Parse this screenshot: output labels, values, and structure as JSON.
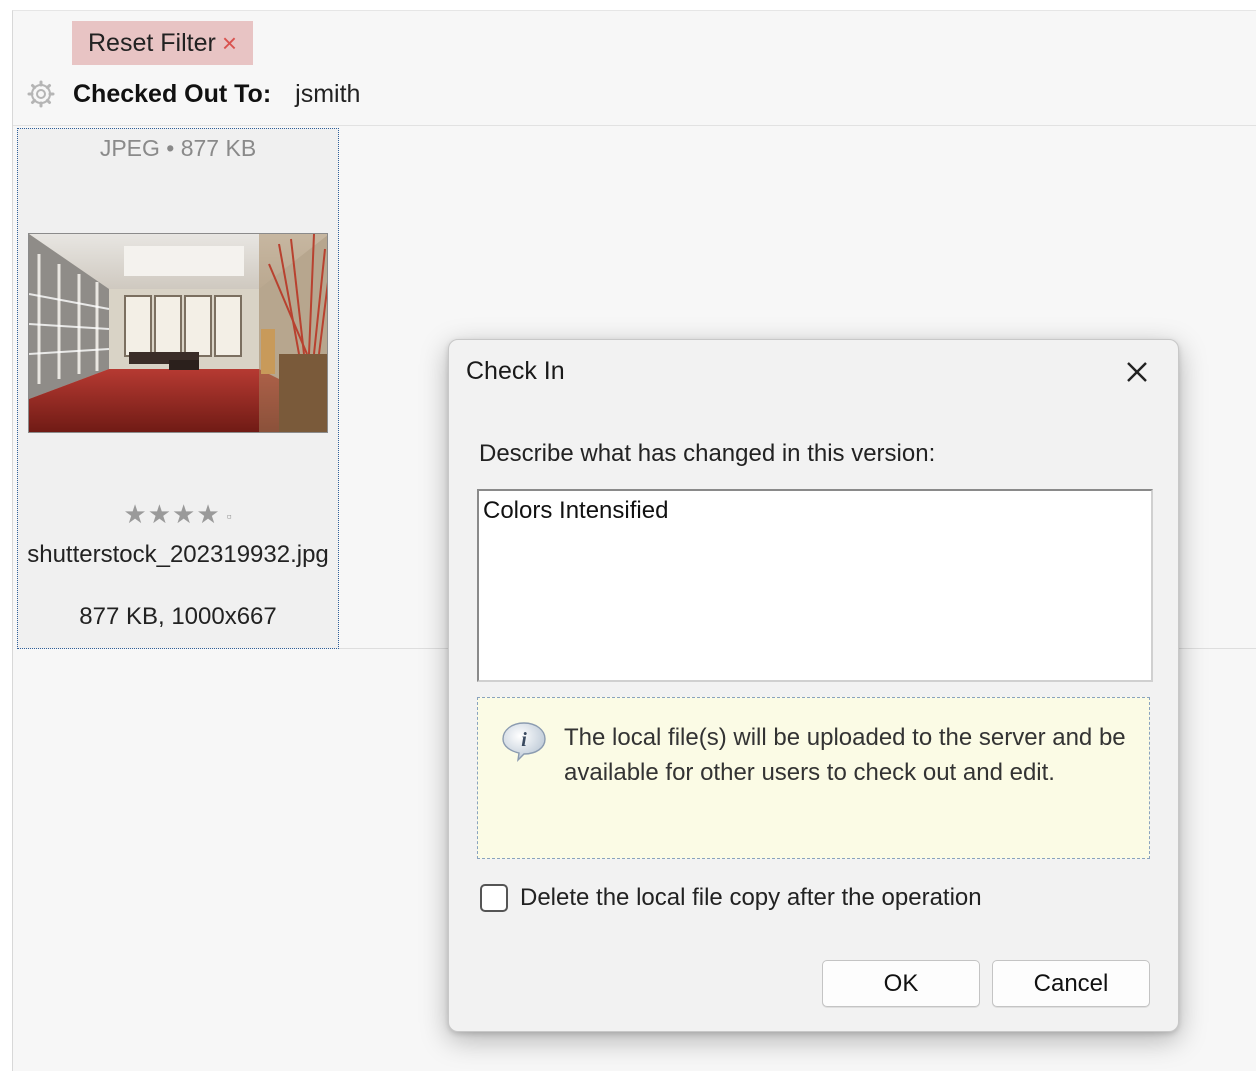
{
  "filter": {
    "reset_label": "Reset Filter",
    "checked_out_label": "Checked Out To:",
    "checked_out_value": "jsmith"
  },
  "asset": {
    "meta": "JPEG • 877 KB",
    "rating_stars": "★★★★",
    "rating_unset": "▫",
    "rating": 4,
    "filename": "shutterstock_202319932.jpg",
    "details": "877 KB, 1000x667"
  },
  "dialog": {
    "title": "Check In",
    "prompt": "Describe what has changed in this version:",
    "comment_value": "Colors Intensified",
    "info_text": "The local file(s) will be uploaded to the server and be available for other users to check out and edit.",
    "delete_local_label": "Delete the local file copy after the operation",
    "delete_local_checked": false,
    "ok_label": "OK",
    "cancel_label": "Cancel"
  },
  "colors": {
    "reset_bg": "#e8c4c4",
    "reset_x": "#d9534f",
    "selection_border": "#2f5f9a",
    "info_bg": "#fbfbe5"
  },
  "icons": {
    "gear": "gear-icon",
    "reset_close": "close-icon",
    "dialog_close": "close-icon",
    "info": "info-icon"
  }
}
